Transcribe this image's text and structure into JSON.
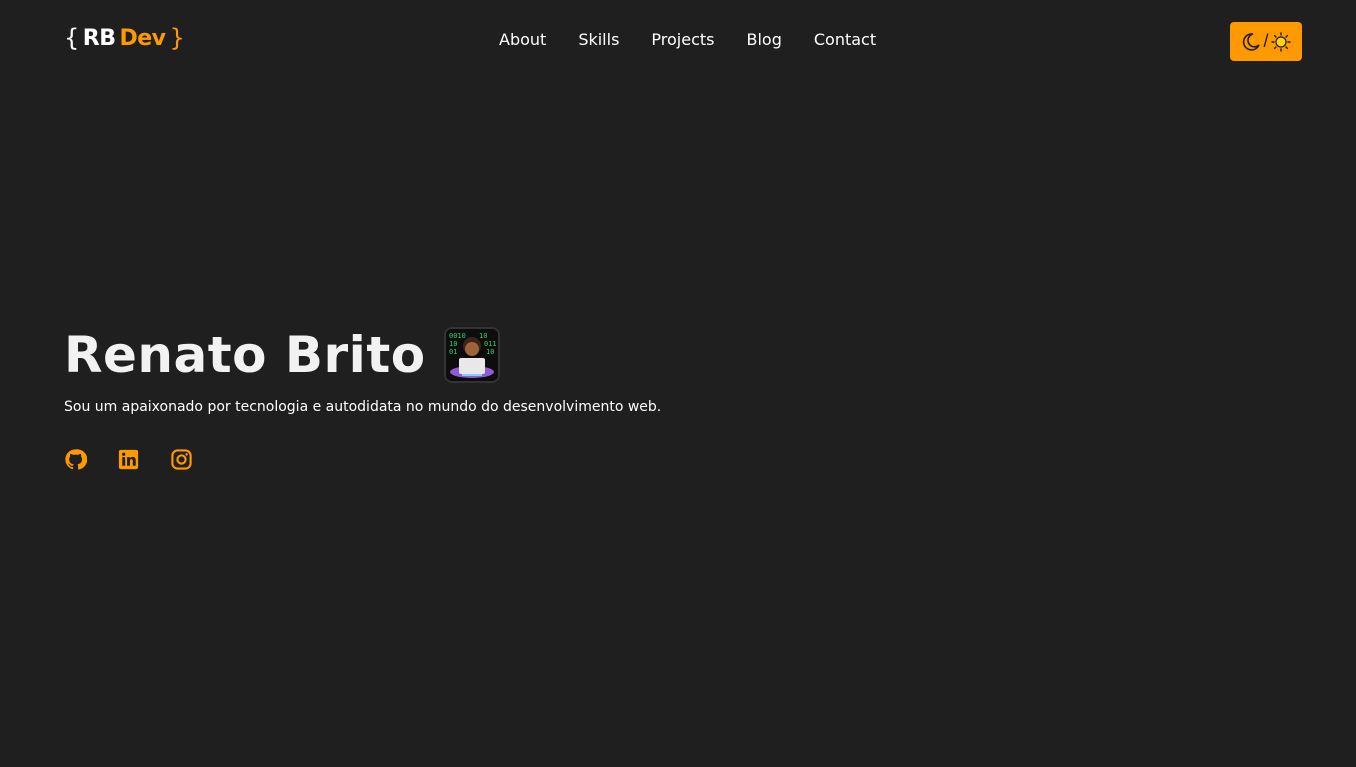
{
  "header": {
    "logo": {
      "open_brace": "{",
      "rb": "RB",
      "dev": "Dev",
      "close_brace": "}"
    },
    "nav": [
      {
        "label": "About"
      },
      {
        "label": "Skills"
      },
      {
        "label": "Projects"
      },
      {
        "label": "Blog"
      },
      {
        "label": "Contact"
      }
    ],
    "theme_toggle": {
      "separator": "/",
      "icons": [
        "moon-icon",
        "sun-icon"
      ]
    }
  },
  "hero": {
    "name": "Renato Brito",
    "emoji_icon": "technologist-emoji",
    "subtitle": "Sou um apaixonado por tecnologia e autodidata no mundo do desenvolvimento web.",
    "socials": [
      "github-icon",
      "linkedin-icon",
      "instagram-icon"
    ]
  },
  "colors": {
    "background": "#1f1f1f",
    "accent": "#ff9900",
    "text": "#ffffff"
  }
}
